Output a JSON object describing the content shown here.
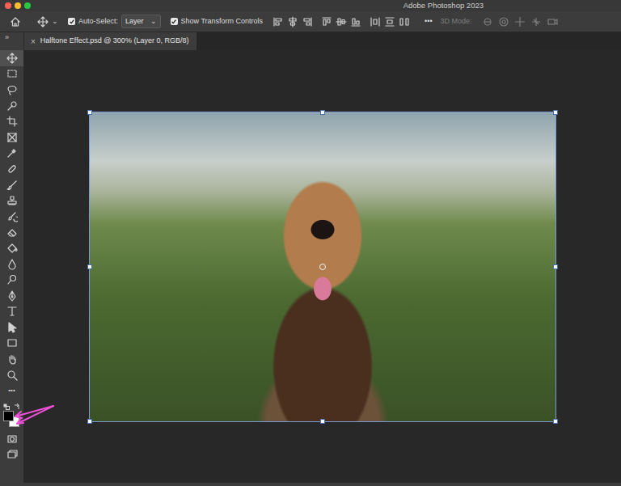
{
  "window": {
    "title": "Adobe Photoshop 2023",
    "controls": [
      {
        "color": "#ff5f57"
      },
      {
        "color": "#febc2e"
      },
      {
        "color": "#28c840"
      }
    ]
  },
  "options_bar": {
    "tool_chevron": "⌄",
    "auto_select": {
      "label": "Auto-Select:",
      "checked": true
    },
    "target": {
      "value": "Layer",
      "chevron": "⌄"
    },
    "transform_controls": {
      "label": "Show Transform Controls",
      "checked": true
    },
    "more": "•••",
    "mode_3d": {
      "label": "3D Mode:",
      "disabled": true
    }
  },
  "tabs": [
    {
      "close": "×",
      "label": "Halftone Effect.psd @ 300% (Layer 0, RGB/8)",
      "selected": true
    }
  ],
  "toolbar": {
    "collapse": "»",
    "tools": [
      {
        "selected": true
      },
      {
        "selected": false
      },
      {
        "selected": false
      },
      {
        "selected": false
      },
      {
        "selected": false
      },
      {
        "selected": false
      },
      {
        "selected": false
      },
      {
        "selected": false
      },
      {
        "selected": false
      },
      {
        "selected": false
      },
      {
        "selected": false
      },
      {
        "selected": false
      },
      {
        "selected": false
      },
      {
        "selected": false
      },
      {
        "selected": false
      },
      {
        "selected": false
      },
      {
        "selected": false
      },
      {
        "selected": false
      },
      {
        "selected": false
      },
      {
        "selected": false
      },
      {
        "selected": false
      }
    ],
    "more": "•••",
    "swatches": {
      "foreground": "#000000",
      "background": "#ffffff"
    },
    "bottom_tools": [
      {
        "selected": false
      },
      {
        "selected": false
      }
    ]
  },
  "canvas": {
    "transform_active": true
  }
}
